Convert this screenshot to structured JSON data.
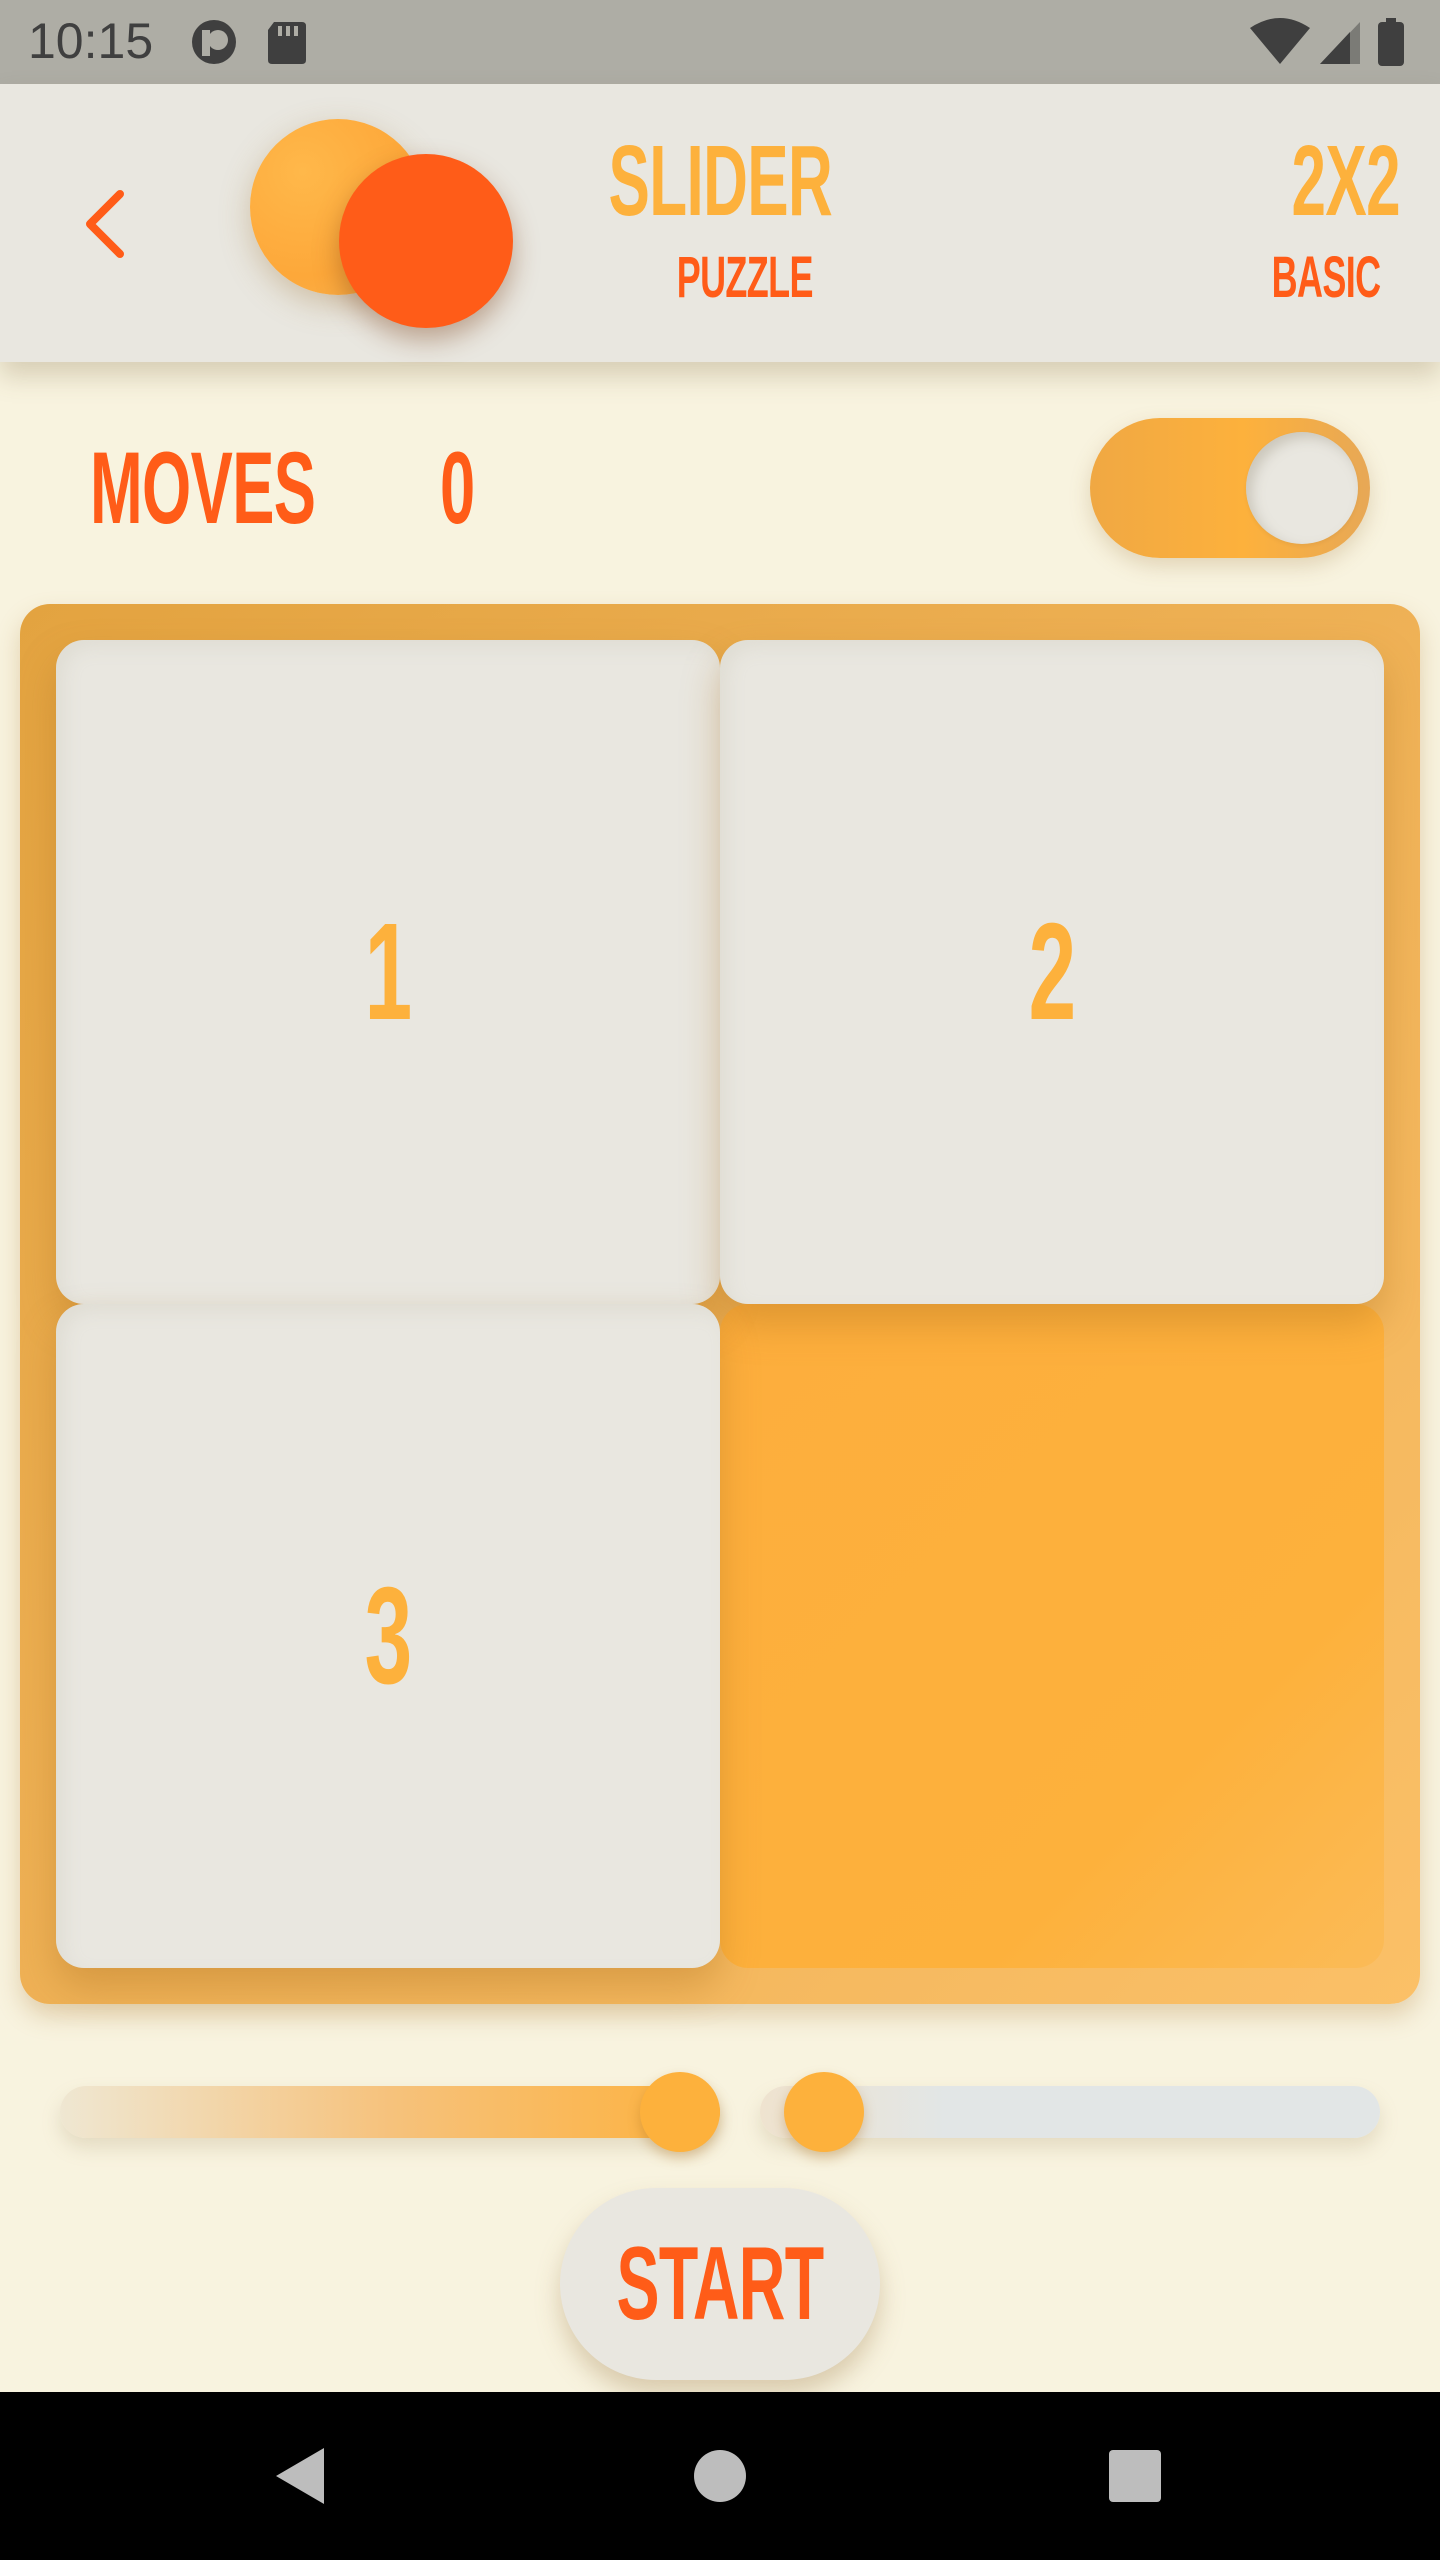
{
  "status_bar": {
    "time": "10:15",
    "left_icons": [
      "notification-app-icon",
      "sd-card-icon"
    ],
    "right_icons": [
      "wifi-icon",
      "signal-icon",
      "battery-icon"
    ]
  },
  "header": {
    "back_icon": "chevron-left-icon",
    "title": "SLIDER",
    "subtitle": "PUZZLE",
    "grid_size": "2X2",
    "difficulty": "BASIC"
  },
  "game": {
    "moves_label": "MOVES",
    "moves_value": "0",
    "toggle_on": true
  },
  "board": {
    "grid": "2x2",
    "tiles": [
      "1",
      "2",
      "3",
      ""
    ]
  },
  "controls": {
    "slider_left_value": 1.0,
    "slider_right_value": 0.0,
    "start_label": "START"
  },
  "colors": {
    "accent_orange": "#ff5c18",
    "accent_yellow": "#fdb13c",
    "tile_bg": "#e9e7e0",
    "page_bg": "#f8f3df"
  },
  "nav_bar": {
    "icons": [
      "back-triangle-icon",
      "home-circle-icon",
      "recents-square-icon"
    ]
  }
}
